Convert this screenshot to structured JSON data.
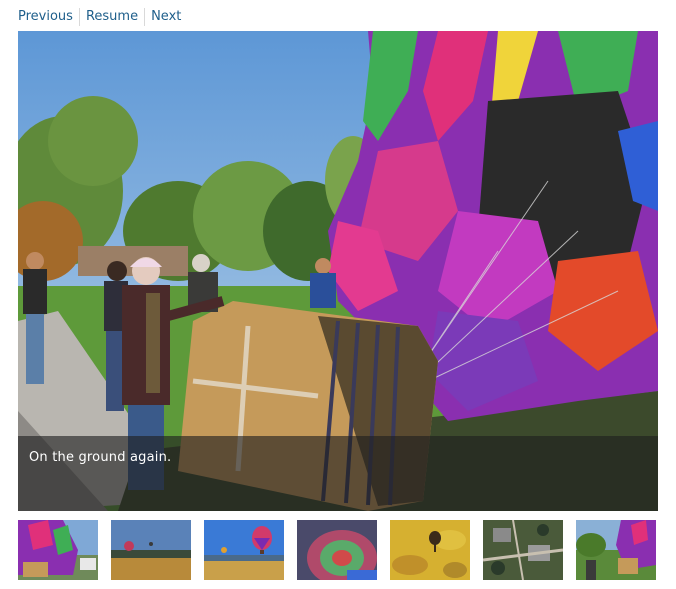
{
  "nav": {
    "previous": "Previous",
    "resume": "Resume",
    "next": "Next"
  },
  "slide": {
    "caption": "On the ground again."
  },
  "colors": {
    "link": "#1f5f8b",
    "caption_bg": "#1e1e1e",
    "sky": "#7fb0de",
    "grass": "#5e9a3a"
  }
}
